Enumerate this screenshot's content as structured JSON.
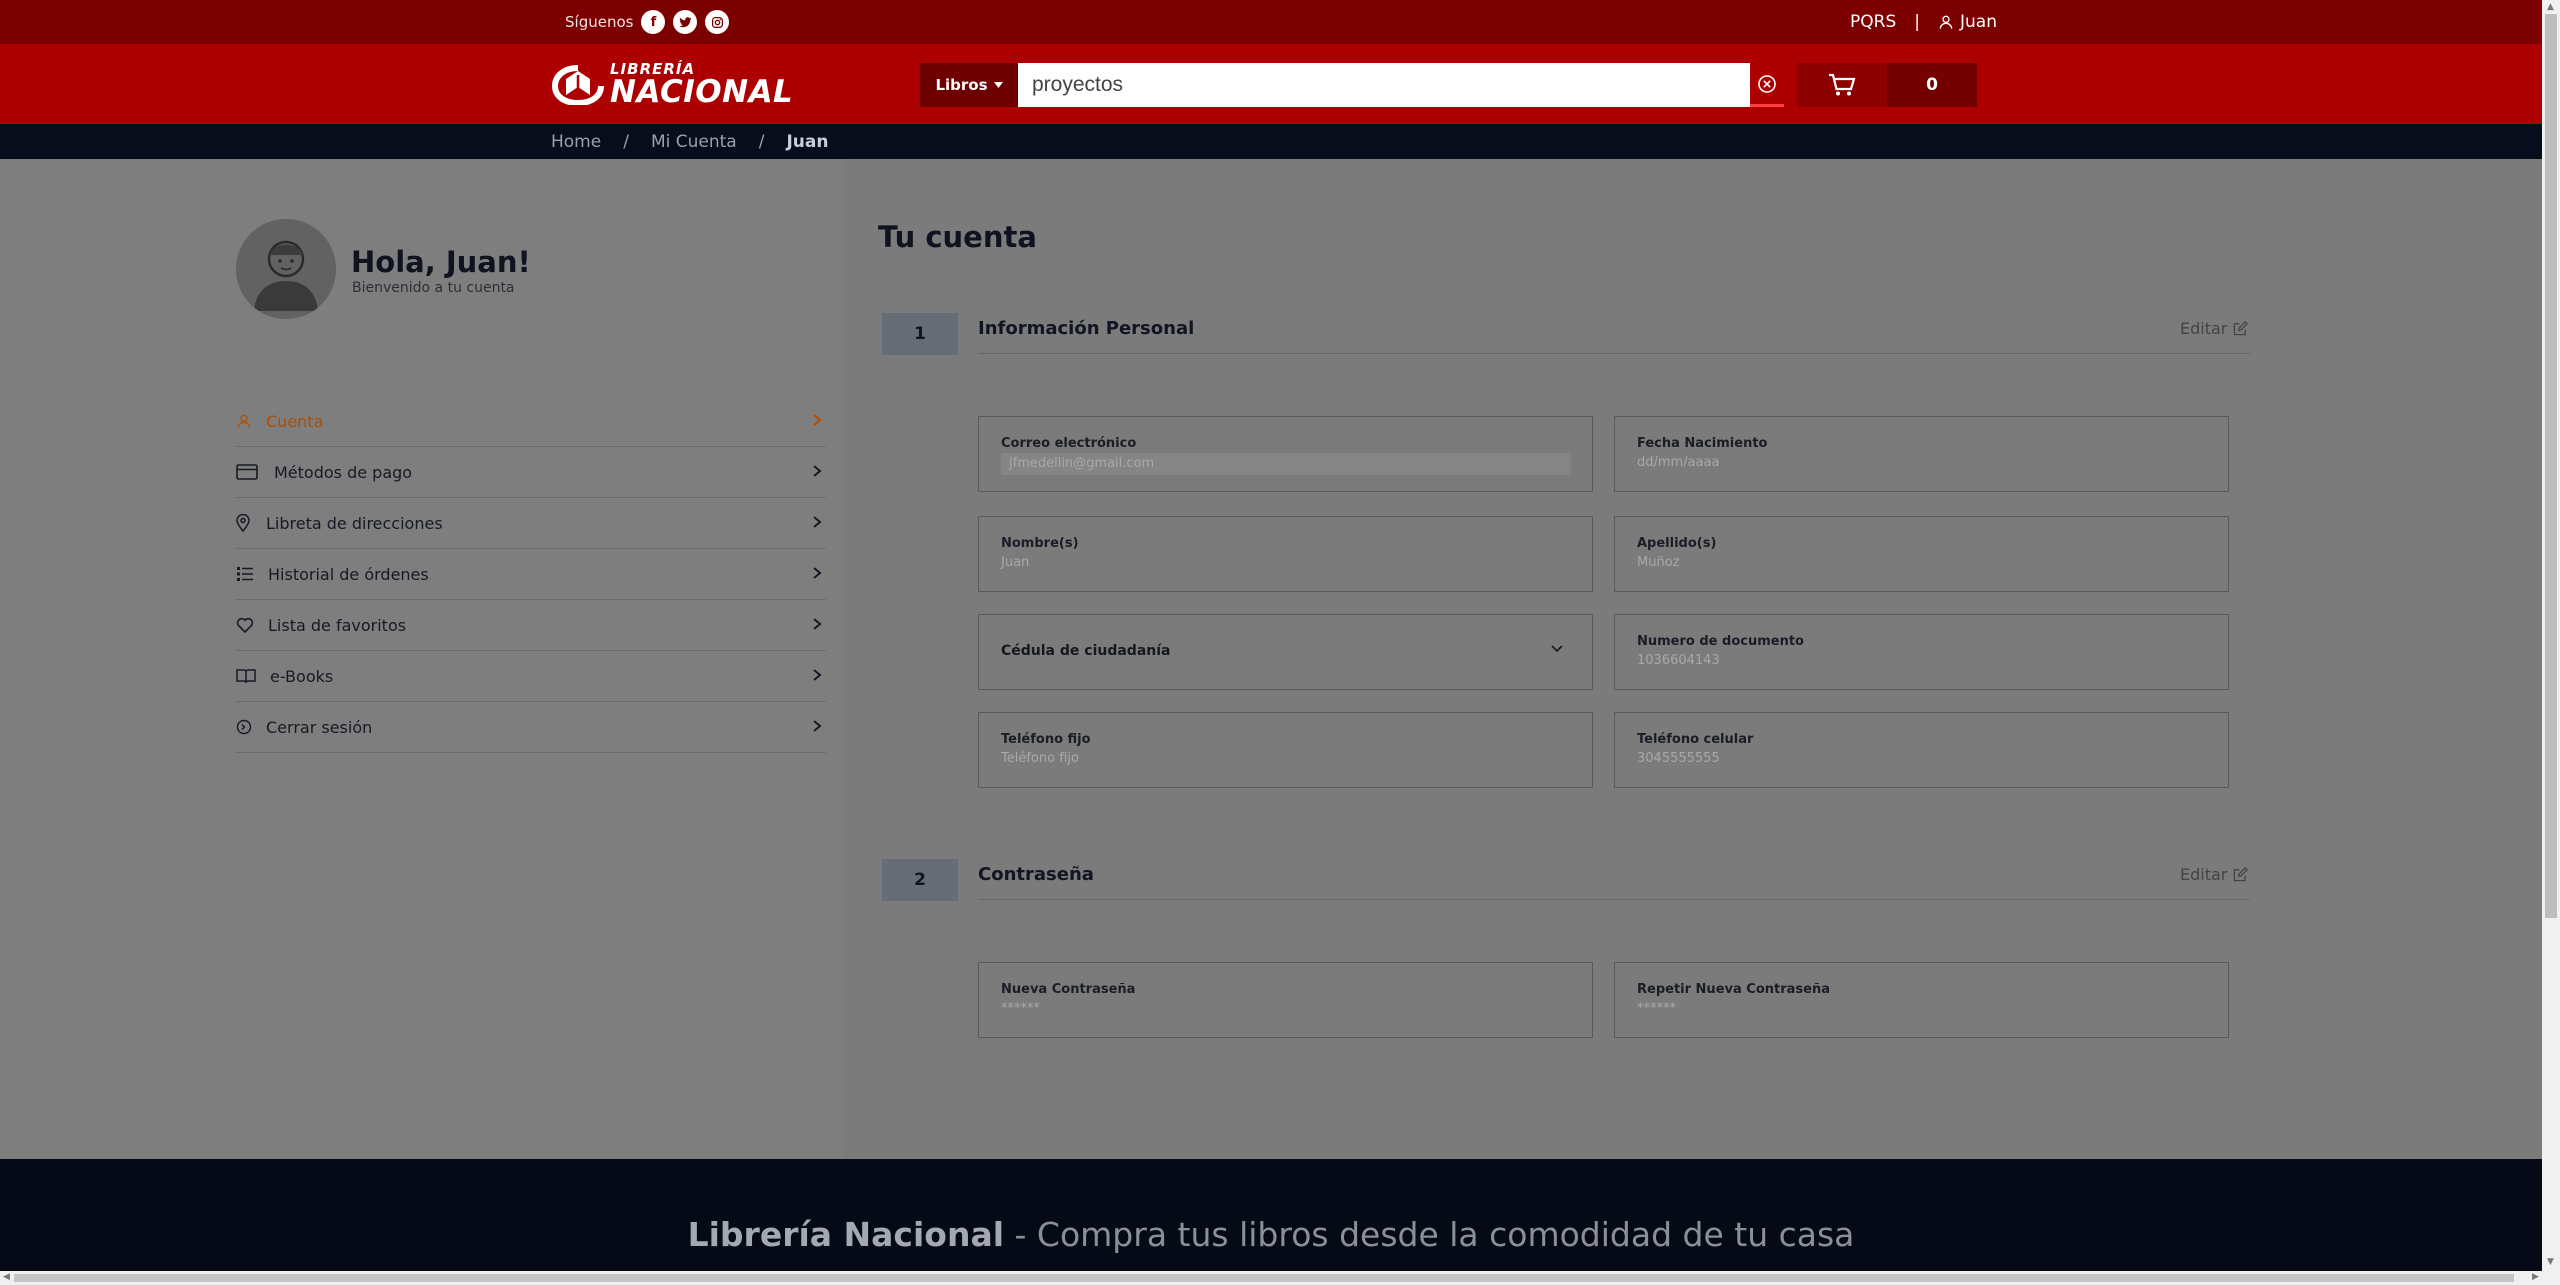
{
  "topbar": {
    "follow_label": "Síguenos",
    "social": [
      "f",
      "t",
      "◎"
    ],
    "pqrs": "PQRS",
    "separator": "|",
    "user_name": "Juan"
  },
  "header": {
    "logo_small": "LIBRERÍA",
    "logo_big": "NACIONAL",
    "category_label": "Libros",
    "search_value": "proyectos",
    "cart_count": "0"
  },
  "breadcrumb": {
    "home": "Home",
    "account": "Mi Cuenta",
    "current": "Juan",
    "divider": "/"
  },
  "profile": {
    "greeting": "Hola, Juan!",
    "welcome": "Bienvenido a tu cuenta"
  },
  "nav": {
    "items": [
      {
        "label": "Cuenta",
        "icon": "user-icon"
      },
      {
        "label": "Métodos de pago",
        "icon": "credit-card-icon"
      },
      {
        "label": "Libreta de direcciones",
        "icon": "map-pin-icon"
      },
      {
        "label": "Historial de órdenes",
        "icon": "list-icon"
      },
      {
        "label": "Lista de favoritos",
        "icon": "heart-icon"
      },
      {
        "label": "e-Books",
        "icon": "book-icon"
      },
      {
        "label": "Cerrar sesión",
        "icon": "logout-icon"
      }
    ]
  },
  "main": {
    "title": "Tu cuenta",
    "edit_label": "Editar",
    "section1": {
      "number": "1",
      "title": "Información Personal",
      "fields": {
        "email": {
          "label": "Correo electrónico",
          "value": "jfmedellin@gmail.com"
        },
        "birth": {
          "label": "Fecha Nacimiento",
          "placeholder": "dd/mm/aaaa"
        },
        "name": {
          "label": "Nombre(s)",
          "value": "Juan"
        },
        "lastname": {
          "label": "Apellido(s)",
          "value": "Muñoz"
        },
        "doc_type": {
          "value": "Cédula de ciudadanía"
        },
        "doc_number": {
          "label": "Numero de documento",
          "value": "1036604143"
        },
        "phone": {
          "label": "Teléfono fijo",
          "placeholder": "Teléfono fijo"
        },
        "mobile": {
          "label": "Teléfono celular",
          "value": "3045555555"
        }
      }
    },
    "section2": {
      "number": "2",
      "title": "Contraseña",
      "fields": {
        "new_password": {
          "label": "Nueva Contraseña",
          "value": "******"
        },
        "repeat_password": {
          "label": "Repetir Nueva Contraseña",
          "value": "******"
        }
      }
    }
  },
  "footer": {
    "brand": "Librería Nacional",
    "tagline": " - Compra tus libros desde la comodidad de tu casa"
  },
  "colors": {
    "topbar": "#7d0000",
    "header": "#ad0000",
    "active_nav": "#b04d00",
    "footer": "#060a17"
  }
}
